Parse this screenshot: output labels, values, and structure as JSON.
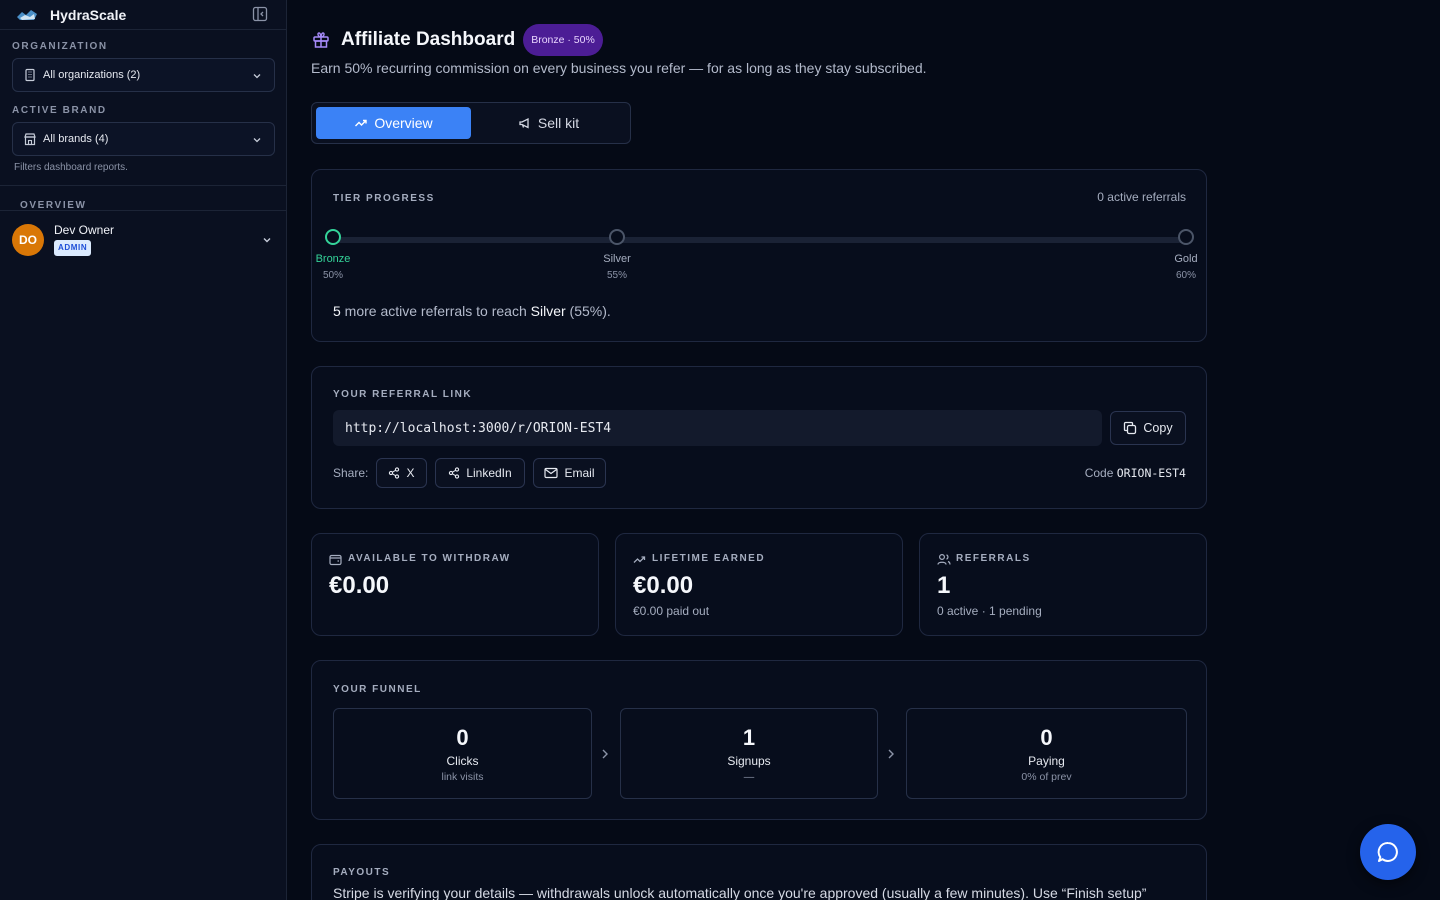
{
  "app": {
    "name": "HydraScale"
  },
  "sidebar": {
    "organization_label": "ORGANIZATION",
    "organization_value": "All organizations (2)",
    "brand_label": "ACTIVE BRAND",
    "brand_value": "All brands (4)",
    "brand_hint": "Filters dashboard reports.",
    "overview_label": "OVERVIEW",
    "user": {
      "initials": "DO",
      "name": "Dev Owner",
      "role": "ADMIN"
    }
  },
  "header": {
    "title": "Affiliate Dashboard",
    "tier_badge": "Bronze · 50%",
    "subtitle": "Earn 50% recurring commission on every business you refer — for as long as they stay subscribed."
  },
  "tabs": [
    {
      "label": "Overview",
      "active": true
    },
    {
      "label": "Sell kit",
      "active": false
    }
  ],
  "tier_progress": {
    "label": "TIER PROGRESS",
    "active_referrals": "0 active referrals",
    "tiers": [
      {
        "name": "Bronze",
        "pct": "50%",
        "reached": true
      },
      {
        "name": "Silver",
        "pct": "55%",
        "reached": false
      },
      {
        "name": "Gold",
        "pct": "60%",
        "reached": false
      }
    ],
    "message_count": "5",
    "message_mid": " more active referrals to reach ",
    "message_tier": "Silver",
    "message_pct": " (55%)."
  },
  "referral": {
    "label": "YOUR REFERRAL LINK",
    "url": "http://localhost:3000/r/ORION-EST4",
    "copy_label": "Copy",
    "share_label": "Share:",
    "share_buttons": [
      "X",
      "LinkedIn",
      "Email"
    ],
    "code_label": "Code",
    "code": "ORION-EST4"
  },
  "stats": [
    {
      "label": "AVAILABLE TO WITHDRAW",
      "value": "€0.00",
      "sub": "",
      "icon": "wallet-icon"
    },
    {
      "label": "LIFETIME EARNED",
      "value": "€0.00",
      "sub": "€0.00 paid out",
      "icon": "trending-up-icon"
    },
    {
      "label": "REFERRALS",
      "value": "1",
      "sub": "0 active · 1 pending",
      "icon": "users-icon"
    }
  ],
  "funnel": {
    "label": "YOUR FUNNEL",
    "steps": [
      {
        "value": "0",
        "name": "Clicks",
        "sub": "link visits"
      },
      {
        "value": "1",
        "name": "Signups",
        "sub": "—"
      },
      {
        "value": "0",
        "name": "Paying",
        "sub": "0% of prev"
      }
    ]
  },
  "payouts": {
    "label": "PAYOUTS",
    "text": "Stripe is verifying your details — withdrawals unlock automatically once you're approved (usually a few minutes). Use “Finish setup”"
  },
  "colors": {
    "accent": "#3b82f6",
    "success": "#34d399",
    "avatar": "#d97706",
    "badge": "#4c1d95"
  }
}
